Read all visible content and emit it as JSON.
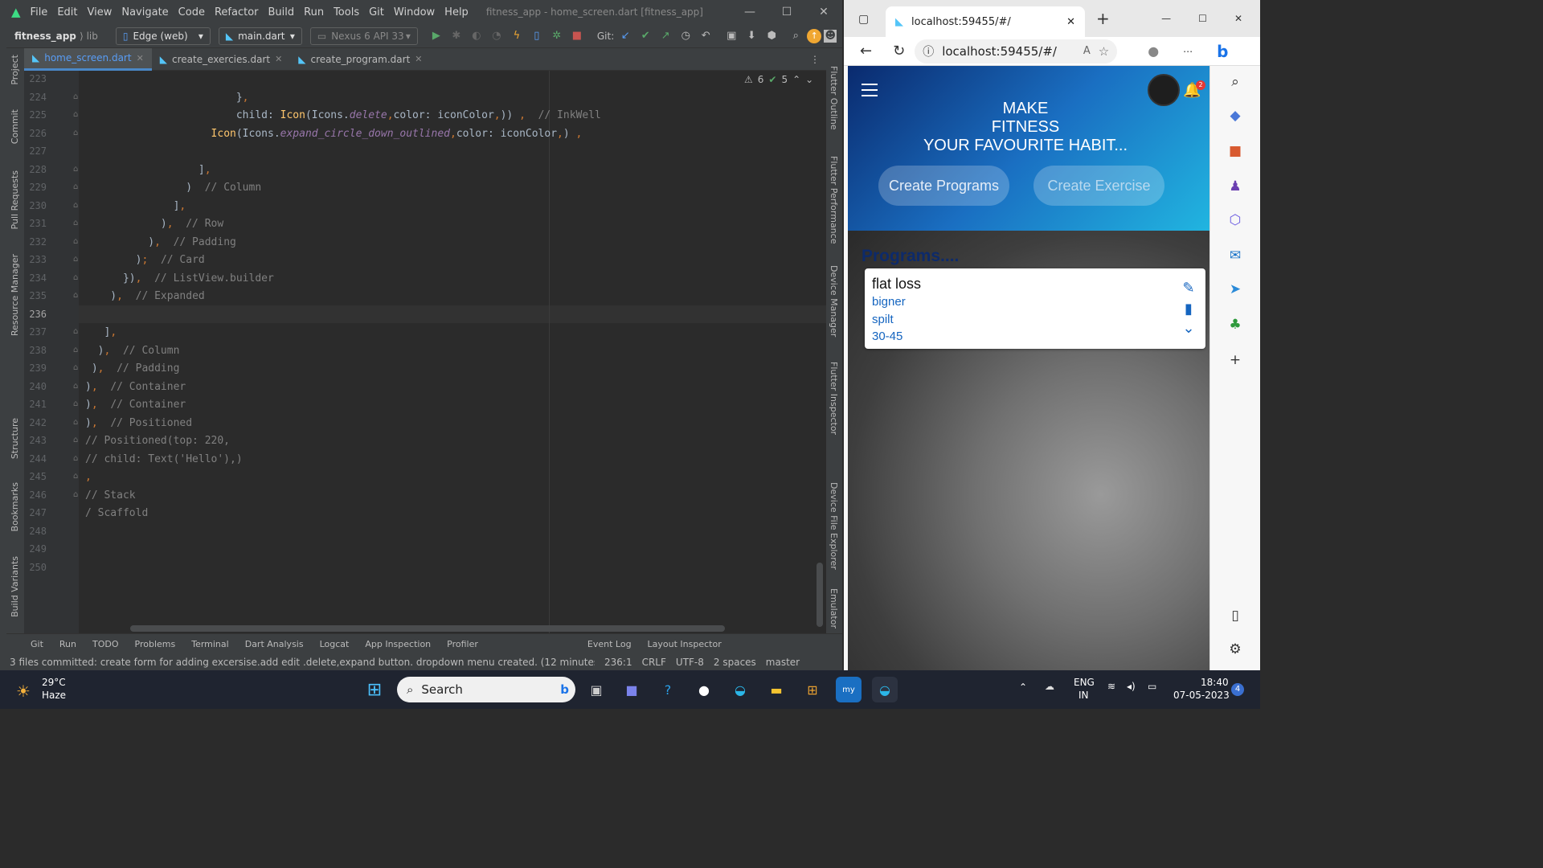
{
  "ide": {
    "menu": [
      "File",
      "Edit",
      "View",
      "Navigate",
      "Code",
      "Refactor",
      "Build",
      "Run",
      "Tools",
      "Git",
      "Window",
      "Help"
    ],
    "window_title": "fitness_app - home_screen.dart [fitness_app]",
    "project": "fitness_app",
    "path_sep": "lib",
    "device": "Edge (web)",
    "config": "main.dart",
    "emulator": "Nexus 6 API 33",
    "git_label": "Git:",
    "tabs": [
      {
        "label": "home_screen.dart",
        "active": true
      },
      {
        "label": "create_exercies.dart",
        "active": false
      },
      {
        "label": "create_program.dart",
        "active": false
      }
    ],
    "left_tools": [
      "Project",
      "Commit",
      "Pull Requests",
      "Resource Manager",
      "Structure",
      "Bookmarks",
      "Build Variants"
    ],
    "right_tools": [
      "Flutter Outline",
      "Flutter Performance",
      "Device Manager",
      "Flutter Inspector",
      "Device File Explorer",
      "Emulator"
    ],
    "inspections": {
      "warnings": "6",
      "ok": "5"
    },
    "line_numbers": [
      "223",
      "224",
      "225",
      "226",
      "227",
      "228",
      "229",
      "230",
      "231",
      "232",
      "233",
      "234",
      "235",
      "236",
      "237",
      "238",
      "239",
      "240",
      "241",
      "242",
      "243",
      "244",
      "245",
      "246",
      "247",
      "248",
      "249",
      "250"
    ],
    "current_line": "236",
    "code": [
      "",
      "                        },",
      "                        child: Icon(Icons.delete,color: iconColor,)) ,  // InkWell",
      "                    Icon(Icons.expand_circle_down_outlined,color: iconColor,) ,",
      "",
      "                  ],",
      "                )  // Column",
      "              ],",
      "            ),  // Row",
      "          ),  // Padding",
      "        );  // Card",
      "      }),  // ListView.builder",
      "    ),  // Expanded",
      "",
      "   ],",
      "  ),  // Column",
      " ),  // Padding",
      "),  // Container",
      "),  // Container",
      "),  // Positioned",
      "// Positioned(top: 220,",
      "// child: Text('Hello'),)",
      ",",
      "// Stack",
      "/ Scaffold",
      "",
      "",
      ""
    ],
    "tool_windows": [
      "Git",
      "Run",
      "TODO",
      "Problems",
      "Terminal",
      "Dart Analysis",
      "Logcat",
      "App Inspection",
      "Profiler",
      "Event Log",
      "Layout Inspector"
    ],
    "status_message": "3 files committed: create form for adding excersise.add edit .delete,expand button. dropdown menu created. (12 minutes ago)",
    "status_right": [
      "236:1",
      "CRLF",
      "UTF-8",
      "2 spaces",
      "master"
    ]
  },
  "browser": {
    "tab_title": "localhost:59455/#/",
    "url": "localhost:59455/#/"
  },
  "app": {
    "hero_lines": [
      "MAKE",
      "FITNESS",
      "YOUR FAVOURITE HABIT..."
    ],
    "btn_programs": "Create Programs",
    "btn_exercise": "Create Exercise",
    "notif_count": "2",
    "section_title": "Programs....",
    "program": {
      "title": "flat loss",
      "level": "bigner",
      "type": "spilt",
      "duration": "30-45"
    }
  },
  "taskbar": {
    "temp": "29°C",
    "weather": "Haze",
    "search": "Search",
    "lang1": "ENG",
    "lang2": "IN",
    "time": "18:40",
    "date": "07-05-2023",
    "notif": "4"
  }
}
